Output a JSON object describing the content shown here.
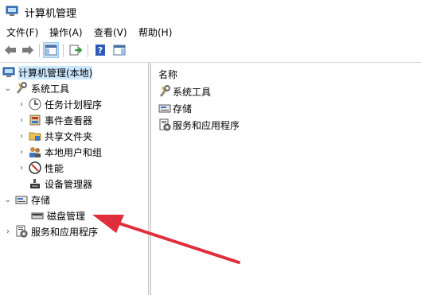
{
  "window": {
    "title": "计算机管理"
  },
  "menu": {
    "file": "文件(F)",
    "action": "操作(A)",
    "view": "查看(V)",
    "help": "帮助(H)"
  },
  "tree": {
    "root": "计算机管理(本地)",
    "system_tools": "系统工具",
    "task_scheduler": "任务计划程序",
    "event_viewer": "事件查看器",
    "shared_folders": "共享文件夹",
    "local_users": "本地用户和组",
    "performance": "性能",
    "device_manager": "设备管理器",
    "storage": "存储",
    "disk_management": "磁盘管理",
    "services": "服务和应用程序"
  },
  "content": {
    "header": "名称",
    "items": [
      "系统工具",
      "存储",
      "服务和应用程序"
    ]
  },
  "colors": {
    "annotation_arrow": "#e02f3c",
    "selection": "#cce8ff"
  }
}
